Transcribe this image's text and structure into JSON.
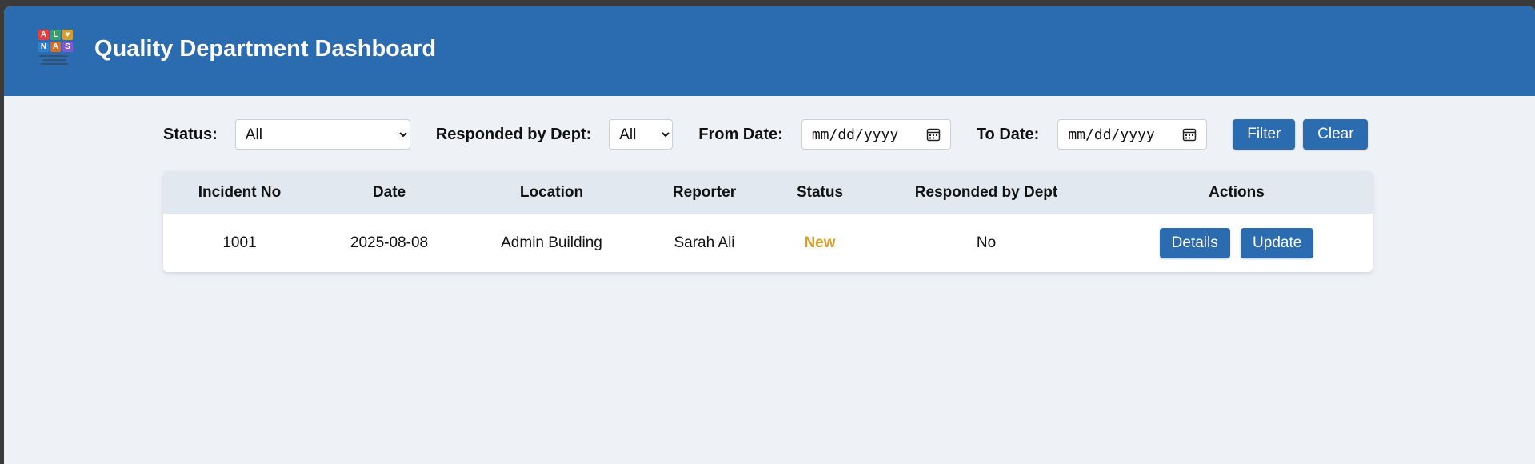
{
  "header": {
    "title": "Quality Department Dashboard",
    "logo": {
      "letters": [
        "A",
        "L",
        "♥",
        "N",
        "A",
        "S"
      ],
      "colors": [
        "#e53e3e",
        "#38a169",
        "#d69e2e",
        "#3182ce",
        "#dd6b20",
        "#805ad5"
      ]
    }
  },
  "filters": {
    "status_label": "Status:",
    "status_value": "All",
    "dept_label": "Responded by Dept:",
    "dept_value": "All",
    "from_label": "From Date:",
    "from_placeholder": "mm/dd/yyyy",
    "to_label": "To Date:",
    "to_placeholder": "mm/dd/yyyy",
    "filter_button": "Filter",
    "clear_button": "Clear"
  },
  "table": {
    "columns": [
      "Incident No",
      "Date",
      "Location",
      "Reporter",
      "Status",
      "Responded by Dept",
      "Actions"
    ],
    "rows": [
      {
        "incident_no": "1001",
        "date": "2025-08-08",
        "location": "Admin Building",
        "reporter": "Sarah Ali",
        "status": "New",
        "responded": "No",
        "details_button": "Details",
        "update_button": "Update"
      }
    ]
  },
  "colors": {
    "primary": "#2b6cb0",
    "status_new": "#d69e2e",
    "background": "#eef2f7"
  }
}
